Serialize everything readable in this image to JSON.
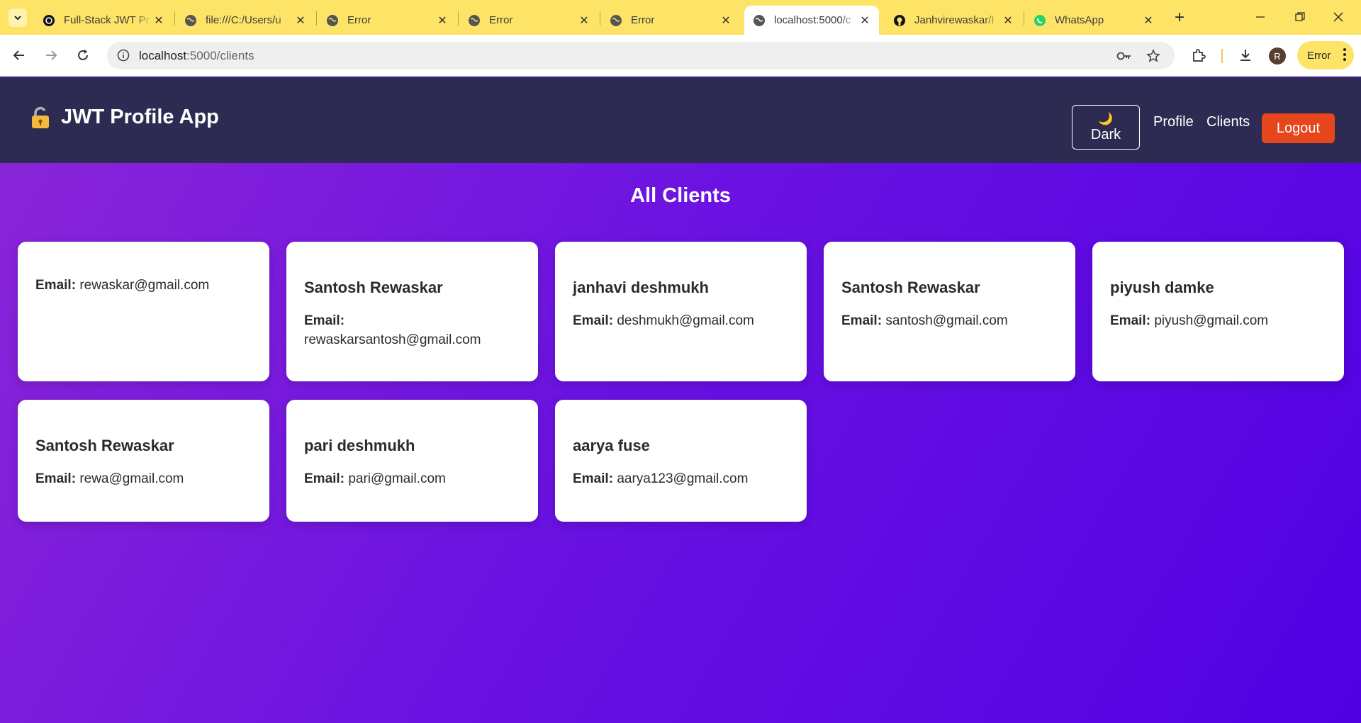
{
  "browser": {
    "tabs": [
      {
        "title": "Full-Stack JWT Pr",
        "icon": "openai-icon",
        "active": false
      },
      {
        "title": "file:///C:/Users/u",
        "icon": "globe-icon",
        "active": false
      },
      {
        "title": "Error",
        "icon": "globe-icon",
        "active": false
      },
      {
        "title": "Error",
        "icon": "globe-icon",
        "active": false
      },
      {
        "title": "Error",
        "icon": "globe-icon",
        "active": false
      },
      {
        "title": "localhost:5000/c",
        "icon": "globe-icon",
        "active": true
      },
      {
        "title": "Janhvirewaskar/I",
        "icon": "github-icon",
        "active": false
      },
      {
        "title": "WhatsApp",
        "icon": "whatsapp-icon",
        "active": false
      }
    ],
    "address": {
      "host": "localhost",
      "path": ":5000/clients"
    },
    "profile_initial": "R",
    "error_label": "Error",
    "colors": {
      "tabstrip": "#fde467",
      "toolbar": "#ffffff"
    }
  },
  "app": {
    "brand": "JWT Profile App",
    "brand_icon": "lock-icon",
    "theme_toggle": {
      "icon": "🌙",
      "label": "Dark"
    },
    "nav": {
      "profile": "Profile",
      "clients": "Clients"
    },
    "logout": "Logout",
    "colors": {
      "header": "#2d2b52",
      "logout": "#e6461b",
      "gradient_start": "#8a24d8",
      "gradient_end": "#5000e3"
    }
  },
  "page": {
    "title": "All Clients",
    "email_label": "Email:",
    "clients": [
      {
        "name": "",
        "email": "rewaskar@gmail.com"
      },
      {
        "name": "Santosh Rewaskar",
        "email": "rewaskarsantosh@gmail.com"
      },
      {
        "name": "janhavi deshmukh",
        "email": "deshmukh@gmail.com"
      },
      {
        "name": "Santosh Rewaskar",
        "email": "santosh@gmail.com"
      },
      {
        "name": "piyush damke",
        "email": "piyush@gmail.com"
      },
      {
        "name": "Santosh Rewaskar",
        "email": "rewa@gmail.com"
      },
      {
        "name": "pari deshmukh",
        "email": "pari@gmail.com"
      },
      {
        "name": "aarya fuse",
        "email": "aarya123@gmail.com"
      }
    ]
  }
}
